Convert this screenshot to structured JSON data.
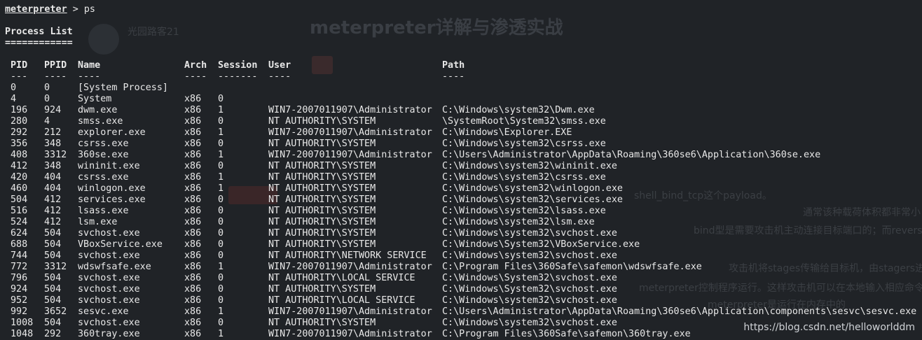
{
  "terminal": {
    "prompt": "meterpreter",
    "prompt_suffix": " > ps",
    "section_title": "Process List",
    "section_underline": "============",
    "headers": {
      "pid": "PID",
      "ppid": "PPID",
      "name": "Name",
      "arch": "Arch",
      "session": "Session",
      "user": "User",
      "path": "Path"
    },
    "separators": {
      "pid": "---",
      "ppid": "----",
      "name": "----",
      "arch": "----",
      "session": "-------",
      "user": "----",
      "path": "----"
    },
    "processes": [
      {
        "pid": "0",
        "ppid": "0",
        "name": "[System Process]",
        "arch": "",
        "session": "",
        "user": "",
        "path": ""
      },
      {
        "pid": "4",
        "ppid": "0",
        "name": "System",
        "arch": "x86",
        "session": "0",
        "user": "",
        "path": ""
      },
      {
        "pid": "196",
        "ppid": "924",
        "name": "dwm.exe",
        "arch": "x86",
        "session": "1",
        "user": "WIN7-2007011907\\Administrator",
        "path": "C:\\Windows\\system32\\Dwm.exe"
      },
      {
        "pid": "280",
        "ppid": "4",
        "name": "smss.exe",
        "arch": "x86",
        "session": "0",
        "user": "NT AUTHORITY\\SYSTEM",
        "path": "\\SystemRoot\\System32\\smss.exe"
      },
      {
        "pid": "292",
        "ppid": "212",
        "name": "explorer.exe",
        "arch": "x86",
        "session": "1",
        "user": "WIN7-2007011907\\Administrator",
        "path": "C:\\Windows\\Explorer.EXE"
      },
      {
        "pid": "356",
        "ppid": "348",
        "name": "csrss.exe",
        "arch": "x86",
        "session": "0",
        "user": "NT AUTHORITY\\SYSTEM",
        "path": "C:\\Windows\\system32\\csrss.exe"
      },
      {
        "pid": "408",
        "ppid": "3312",
        "name": "360se.exe",
        "arch": "x86",
        "session": "1",
        "user": "WIN7-2007011907\\Administrator",
        "path": "C:\\Users\\Administrator\\AppData\\Roaming\\360se6\\Application\\360se.exe"
      },
      {
        "pid": "412",
        "ppid": "348",
        "name": "wininit.exe",
        "arch": "x86",
        "session": "0",
        "user": "NT AUTHORITY\\SYSTEM",
        "path": "C:\\Windows\\system32\\wininit.exe"
      },
      {
        "pid": "420",
        "ppid": "404",
        "name": "csrss.exe",
        "arch": "x86",
        "session": "1",
        "user": "NT AUTHORITY\\SYSTEM",
        "path": "C:\\Windows\\system32\\csrss.exe"
      },
      {
        "pid": "460",
        "ppid": "404",
        "name": "winlogon.exe",
        "arch": "x86",
        "session": "1",
        "user": "NT AUTHORITY\\SYSTEM",
        "path": "C:\\Windows\\system32\\winlogon.exe"
      },
      {
        "pid": "504",
        "ppid": "412",
        "name": "services.exe",
        "arch": "x86",
        "session": "0",
        "user": "NT AUTHORITY\\SYSTEM",
        "path": "C:\\Windows\\system32\\services.exe"
      },
      {
        "pid": "516",
        "ppid": "412",
        "name": "lsass.exe",
        "arch": "x86",
        "session": "0",
        "user": "NT AUTHORITY\\SYSTEM",
        "path": "C:\\Windows\\system32\\lsass.exe"
      },
      {
        "pid": "524",
        "ppid": "412",
        "name": "lsm.exe",
        "arch": "x86",
        "session": "0",
        "user": "NT AUTHORITY\\SYSTEM",
        "path": "C:\\Windows\\system32\\lsm.exe"
      },
      {
        "pid": "624",
        "ppid": "504",
        "name": "svchost.exe",
        "arch": "x86",
        "session": "0",
        "user": "NT AUTHORITY\\SYSTEM",
        "path": "C:\\Windows\\system32\\svchost.exe"
      },
      {
        "pid": "688",
        "ppid": "504",
        "name": "VBoxService.exe",
        "arch": "x86",
        "session": "0",
        "user": "NT AUTHORITY\\SYSTEM",
        "path": "C:\\Windows\\System32\\VBoxService.exe"
      },
      {
        "pid": "744",
        "ppid": "504",
        "name": "svchost.exe",
        "arch": "x86",
        "session": "0",
        "user": "NT AUTHORITY\\NETWORK SERVICE",
        "path": "C:\\Windows\\system32\\svchost.exe"
      },
      {
        "pid": "772",
        "ppid": "3312",
        "name": "wdswfsafe.exe",
        "arch": "x86",
        "session": "1",
        "user": "WIN7-2007011907\\Administrator",
        "path": "C:\\Program Files\\360Safe\\safemon\\wdswfsafe.exe"
      },
      {
        "pid": "796",
        "ppid": "504",
        "name": "svchost.exe",
        "arch": "x86",
        "session": "0",
        "user": "NT AUTHORITY\\LOCAL SERVICE",
        "path": "C:\\Windows\\System32\\svchost.exe"
      },
      {
        "pid": "924",
        "ppid": "504",
        "name": "svchost.exe",
        "arch": "x86",
        "session": "0",
        "user": "NT AUTHORITY\\SYSTEM",
        "path": "C:\\Windows\\System32\\svchost.exe"
      },
      {
        "pid": "952",
        "ppid": "504",
        "name": "svchost.exe",
        "arch": "x86",
        "session": "0",
        "user": "NT AUTHORITY\\LOCAL SERVICE",
        "path": "C:\\Windows\\system32\\svchost.exe"
      },
      {
        "pid": "992",
        "ppid": "3652",
        "name": "sesvc.exe",
        "arch": "x86",
        "session": "1",
        "user": "WIN7-2007011907\\Administrator",
        "path": "C:\\Users\\Administrator\\AppData\\Roaming\\360se6\\Application\\components\\sesvc\\sesvc.exe"
      },
      {
        "pid": "1008",
        "ppid": "504",
        "name": "svchost.exe",
        "arch": "x86",
        "session": "0",
        "user": "NT AUTHORITY\\SYSTEM",
        "path": "C:\\Windows\\system32\\svchost.exe"
      },
      {
        "pid": "1048",
        "ppid": "292",
        "name": "360tray.exe",
        "arch": "x86",
        "session": "1",
        "user": "WIN7-2007011907\\Administrator",
        "path": "C:\\Program Files\\360Safe\\safemon\\360tray.exe"
      }
    ]
  },
  "background_article": {
    "title": "meterpreter详解与渗透实战",
    "author": "光园路客21",
    "lines": [
      "shell_bind_tcp这个payload。",
      "通常该种载荷体积都非常小",
      "bind型是需要攻击机主动连接目标端口的；而reverse",
      "攻击机将stages传输给目标机，由stagers进",
      "meterpreter控制程序运行。这样攻击机可以在本地输入相应命令",
      "meterpreter是运行在内存中的"
    ]
  },
  "watermark": "https://blog.csdn.net/helloworlddm"
}
